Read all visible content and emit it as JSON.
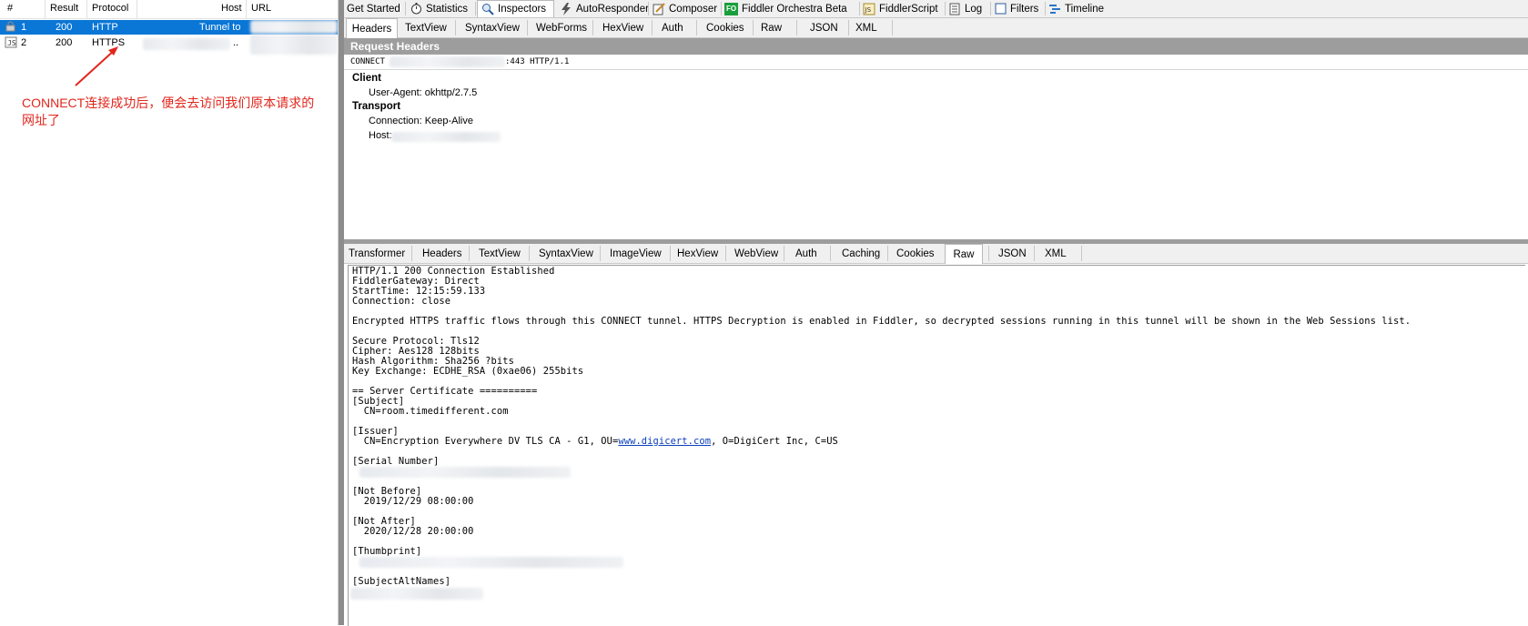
{
  "sessions": {
    "columns": [
      "#",
      "Result",
      "Protocol",
      "Host",
      "URL"
    ],
    "rows": [
      {
        "num": "1",
        "result": "200",
        "protocol": "HTTP",
        "host": "Tunnel to",
        "selected": true,
        "icon": "lock-icon"
      },
      {
        "num": "2",
        "result": "200",
        "protocol": "HTTPS",
        "host": "..",
        "selected": false,
        "icon": "script-icon"
      }
    ]
  },
  "annotation": {
    "text": "CONNECT连接成功后，便会去访问我们原本请求的网址了",
    "color": "#e1261c"
  },
  "main_tabs": [
    {
      "label": "Get Started",
      "icon": ""
    },
    {
      "label": "Statistics",
      "icon": "stopwatch-icon"
    },
    {
      "label": "Inspectors",
      "icon": "magnifier-icon",
      "active": true
    },
    {
      "label": "AutoResponder",
      "icon": "lightning-icon"
    },
    {
      "label": "Composer",
      "icon": "pencil-icon"
    },
    {
      "label": "Fiddler Orchestra Beta",
      "icon": "fo-icon"
    },
    {
      "label": "FiddlerScript",
      "icon": "js-icon"
    },
    {
      "label": "Log",
      "icon": "log-icon"
    },
    {
      "label": "Filters",
      "icon": "checkbox-icon"
    },
    {
      "label": "Timeline",
      "icon": "timeline-icon"
    }
  ],
  "request_tabs": [
    "Headers",
    "TextView",
    "SyntaxView",
    "WebForms",
    "HexView",
    "Auth",
    "Cookies",
    "Raw",
    "JSON",
    "XML"
  ],
  "request": {
    "title": "Request Headers",
    "line_prefix": "CONNECT",
    "line_suffix": ":443 HTTP/1.1",
    "groups": [
      {
        "name": "Client",
        "items": [
          "User-Agent: okhttp/2.7.5"
        ]
      },
      {
        "name": "Transport",
        "items": [
          "Connection: Keep-Alive",
          "Host:"
        ]
      }
    ]
  },
  "response_tabs": [
    "Transformer",
    "Headers",
    "TextView",
    "SyntaxView",
    "ImageView",
    "HexView",
    "WebView",
    "Auth",
    "Caching",
    "Cookies",
    "Raw",
    "JSON",
    "XML"
  ],
  "response_active_tab": "Raw",
  "response_lines": [
    "HTTP/1.1 200 Connection Established",
    "FiddlerGateway: Direct",
    "StartTime: 12:15:59.133",
    "Connection: close",
    "",
    "Encrypted HTTPS traffic flows through this CONNECT tunnel. HTTPS Decryption is enabled in Fiddler, so decrypted sessions running in this tunnel will be shown in the Web Sessions list.",
    "",
    "Secure Protocol: Tls12",
    "Cipher: Aes128 128bits",
    "Hash Algorithm: Sha256 ?bits",
    "Key Exchange: ECDHE_RSA (0xae06) 255bits",
    "",
    "== Server Certificate ==========",
    "[Subject]",
    "  CN=room.timedifferent.com",
    "",
    "[Issuer]",
    "",
    "",
    "[Serial Number]",
    "",
    "",
    "[Not Before]",
    "  2019/12/29 08:00:00",
    "",
    "[Not After]",
    "  2020/12/28 20:00:00",
    "",
    "[Thumbprint]",
    "",
    "",
    "[SubjectAltNames]"
  ],
  "issuer": {
    "prefix": "  CN=Encryption Everywhere DV TLS CA - G1, OU=",
    "link": "www.digicert.com",
    "suffix": ", O=DigiCert Inc, C=US"
  }
}
